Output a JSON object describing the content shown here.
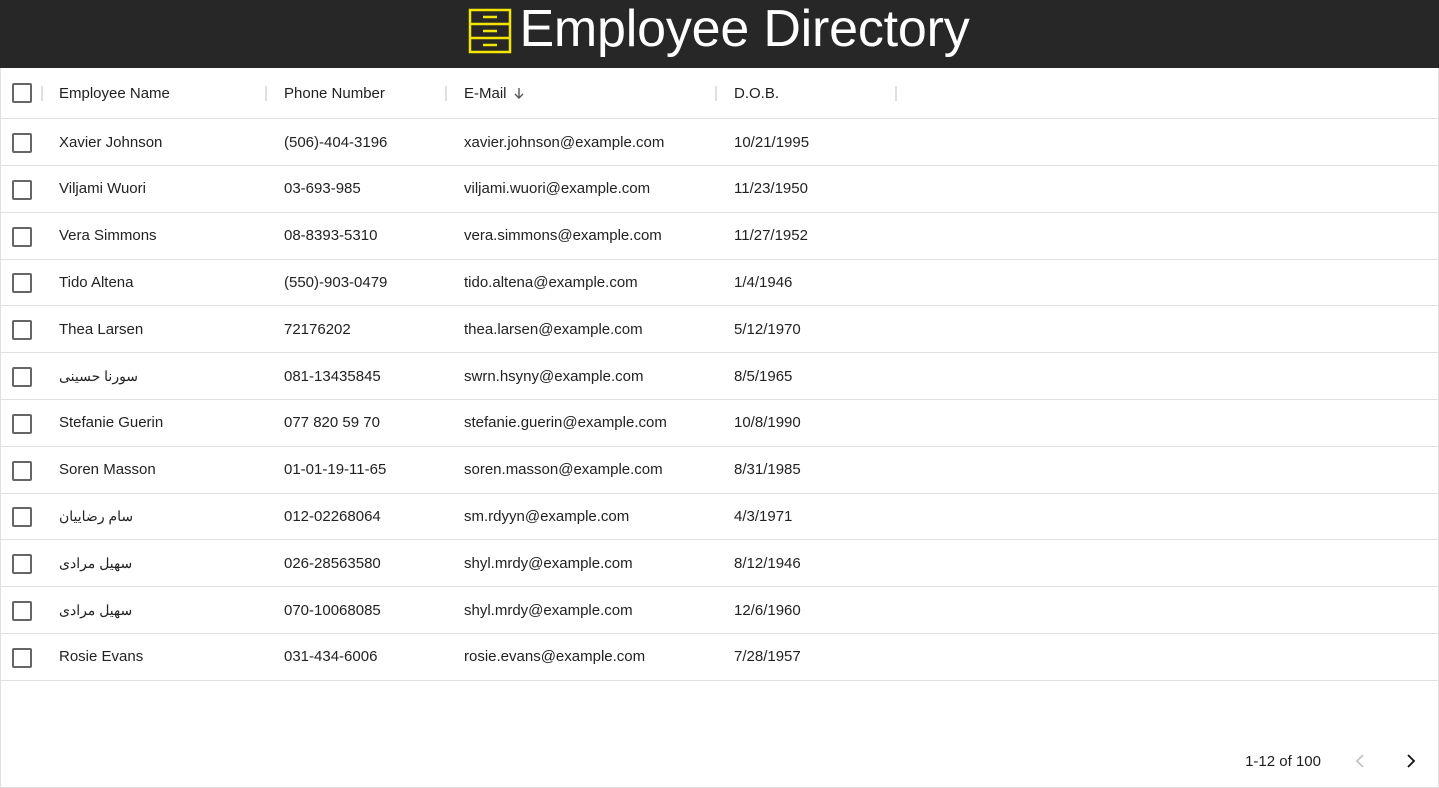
{
  "header": {
    "title": "Employee Directory",
    "icon": "file-cabinet-icon",
    "icon_color": "#f2e600",
    "background": "#272727"
  },
  "grid": {
    "columns": [
      {
        "key": "name",
        "label": "Employee Name"
      },
      {
        "key": "phone",
        "label": "Phone Number"
      },
      {
        "key": "email",
        "label": "E-Mail",
        "sort": "descending"
      },
      {
        "key": "dob",
        "label": "D.O.B."
      }
    ],
    "rows": [
      {
        "name": "Xavier Johnson",
        "phone": "(506)-404-3196",
        "email": "xavier.johnson@example.com",
        "dob": "10/21/1995"
      },
      {
        "name": "Viljami Wuori",
        "phone": "03-693-985",
        "email": "viljami.wuori@example.com",
        "dob": "11/23/1950"
      },
      {
        "name": "Vera Simmons",
        "phone": "08-8393-5310",
        "email": "vera.simmons@example.com",
        "dob": "11/27/1952"
      },
      {
        "name": "Tido Altena",
        "phone": "(550)-903-0479",
        "email": "tido.altena@example.com",
        "dob": "1/4/1946"
      },
      {
        "name": "Thea Larsen",
        "phone": "72176202",
        "email": "thea.larsen@example.com",
        "dob": "5/12/1970"
      },
      {
        "name": "سورنا حسینی",
        "phone": "081-13435845",
        "email": "swrn.hsyny@example.com",
        "dob": "8/5/1965"
      },
      {
        "name": "Stefanie Guerin",
        "phone": "077 820 59 70",
        "email": "stefanie.guerin@example.com",
        "dob": "10/8/1990"
      },
      {
        "name": "Soren Masson",
        "phone": "01-01-19-11-65",
        "email": "soren.masson@example.com",
        "dob": "8/31/1985"
      },
      {
        "name": "سام رضاییان",
        "phone": "012-02268064",
        "email": "sm.rdyyn@example.com",
        "dob": "4/3/1971"
      },
      {
        "name": "سهیل مرادی",
        "phone": "026-28563580",
        "email": "shyl.mrdy@example.com",
        "dob": "8/12/1946"
      },
      {
        "name": "سهیل مرادی",
        "phone": "070-10068085",
        "email": "shyl.mrdy@example.com",
        "dob": "12/6/1960"
      },
      {
        "name": "Rosie Evans",
        "phone": "031-434-6006",
        "email": "rosie.evans@example.com",
        "dob": "7/28/1957"
      }
    ]
  },
  "pagination": {
    "range_label": "1-12 of 100",
    "prev_icon": "chevron-left-icon",
    "next_icon": "chevron-right-icon"
  }
}
